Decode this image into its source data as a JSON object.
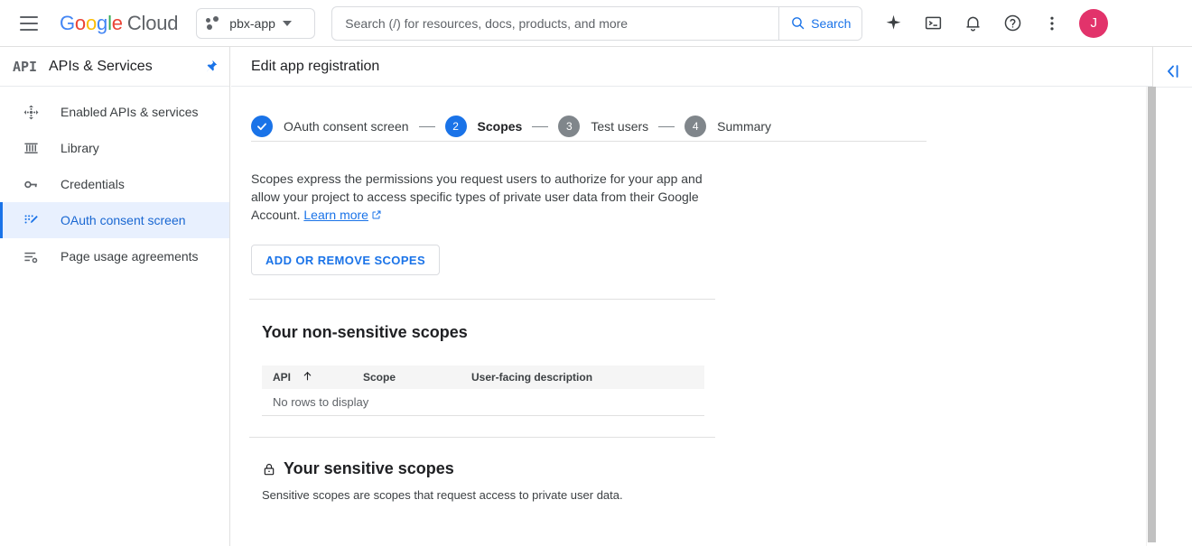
{
  "topbar": {
    "menu_icon": "hamburger-icon",
    "logo": {
      "google": "Google",
      "cloud": "Cloud"
    },
    "project": {
      "name": "pbx-app",
      "icon": "project-dots-icon"
    },
    "search": {
      "placeholder": "Search (/) for resources, docs, products, and more",
      "value": "",
      "button_label": "Search",
      "button_icon": "search-icon"
    },
    "icons": [
      {
        "name": "gemini-spark-icon"
      },
      {
        "name": "cloud-shell-icon"
      },
      {
        "name": "notifications-bell-icon"
      },
      {
        "name": "help-question-icon"
      },
      {
        "name": "more-vert-icon"
      }
    ],
    "avatar_initial": "J",
    "avatar_color": "#e2336b"
  },
  "sidebar": {
    "logo_text": "API",
    "title": "APIs & Services",
    "pin_icon": "pin-icon",
    "items": [
      {
        "label": "Enabled APIs & services",
        "icon": "dashboard-move-icon",
        "active": false
      },
      {
        "label": "Library",
        "icon": "library-icon",
        "active": false
      },
      {
        "label": "Credentials",
        "icon": "key-icon",
        "active": false
      },
      {
        "label": "OAuth consent screen",
        "icon": "oauth-consent-icon",
        "active": true
      },
      {
        "label": "Page usage agreements",
        "icon": "page-usage-icon",
        "active": false
      }
    ]
  },
  "main": {
    "page_title": "Edit app registration",
    "stepper": [
      {
        "num": "",
        "label": "OAuth consent screen",
        "state": "done"
      },
      {
        "num": "2",
        "label": "Scopes",
        "state": "current"
      },
      {
        "num": "3",
        "label": "Test users",
        "state": "todo"
      },
      {
        "num": "4",
        "label": "Summary",
        "state": "todo"
      }
    ],
    "description": "Scopes express the permissions you request users to authorize for your app and allow your project to access specific types of private user data from their Google Account.",
    "learn_more": "Learn more",
    "add_remove_button": "ADD OR REMOVE SCOPES",
    "non_sensitive": {
      "title": "Your non-sensitive scopes",
      "columns": [
        "API",
        "Scope",
        "User-facing description"
      ],
      "sort_column": "API",
      "sort_direction": "ascending",
      "empty_text": "No rows to display",
      "rows": []
    },
    "sensitive": {
      "title": "Your sensitive scopes",
      "lock_icon": "lock-icon",
      "subtitle": "Sensitive scopes are scopes that request access to private user data."
    }
  },
  "right_rail": {
    "collapse_icon": "collapse-panel-icon"
  },
  "colors": {
    "accent_blue": "#1a73e8",
    "active_bg": "#e8f0fe",
    "active_text": "#1967d2",
    "border": "#e0e0e0",
    "table_header_bg": "#f5f5f5",
    "muted_text": "#5f6368",
    "step_todo": "#80868b"
  }
}
